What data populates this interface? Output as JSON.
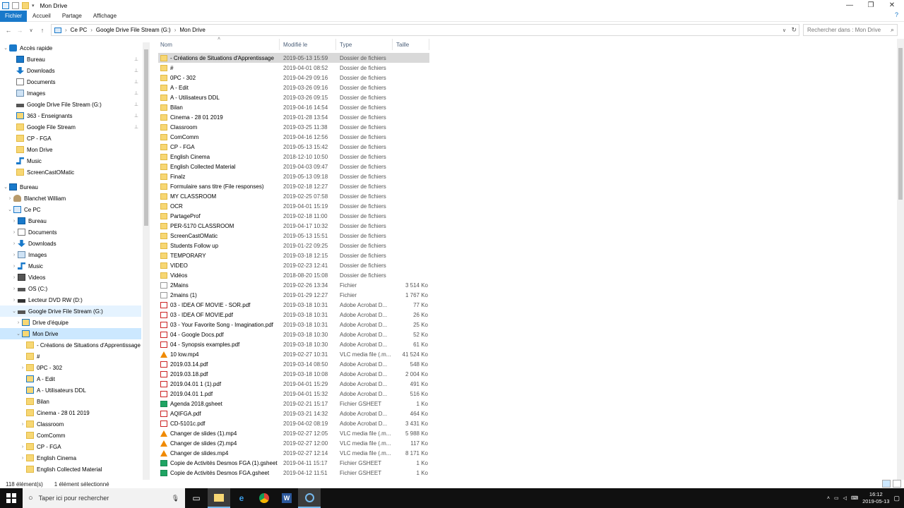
{
  "window": {
    "title": "Mon Drive"
  },
  "ribbon": {
    "tabs": [
      "Fichier",
      "Accueil",
      "Partage",
      "Affichage"
    ]
  },
  "address": {
    "segments": [
      "Ce PC",
      "Google Drive File Stream (G:)",
      "Mon Drive"
    ],
    "search_placeholder": "Rechercher dans : Mon Drive"
  },
  "nav": {
    "items": [
      {
        "label": "Accès rapide",
        "level": 0,
        "chev": "v",
        "icon": "star"
      },
      {
        "label": "Bureau",
        "level": 1,
        "icon": "desktop",
        "pin": true
      },
      {
        "label": "Downloads",
        "level": 1,
        "icon": "download",
        "pin": true
      },
      {
        "label": "Documents",
        "level": 1,
        "icon": "doc",
        "pin": true
      },
      {
        "label": "Images",
        "level": 1,
        "icon": "image",
        "pin": true
      },
      {
        "label": "Google Drive File Stream (G:)",
        "level": 1,
        "icon": "drive",
        "pin": true
      },
      {
        "label": "363 - Enseignants",
        "level": 1,
        "icon": "shared",
        "pin": true
      },
      {
        "label": "Google File Stream",
        "level": 1,
        "icon": "folder",
        "pin": true
      },
      {
        "label": "CP - FGA",
        "level": 1,
        "icon": "folder"
      },
      {
        "label": "Mon Drive",
        "level": 1,
        "icon": "folder"
      },
      {
        "label": "Music",
        "level": 1,
        "icon": "music"
      },
      {
        "label": "ScreenCastOMatic",
        "level": 1,
        "icon": "folder"
      },
      {
        "label": "Bureau",
        "level": 0,
        "chev": "v",
        "icon": "desktop",
        "gap": true
      },
      {
        "label": "Blanchet William",
        "level": 1,
        "chev": ">",
        "icon": "user"
      },
      {
        "label": "Ce PC",
        "level": 1,
        "chev": "v",
        "icon": "pc"
      },
      {
        "label": "Bureau",
        "level": 2,
        "chev": ">",
        "icon": "desktop"
      },
      {
        "label": "Documents",
        "level": 2,
        "chev": ">",
        "icon": "doc"
      },
      {
        "label": "Downloads",
        "level": 2,
        "chev": ">",
        "icon": "download"
      },
      {
        "label": "Images",
        "level": 2,
        "chev": ">",
        "icon": "image"
      },
      {
        "label": "Music",
        "level": 2,
        "chev": ">",
        "icon": "music"
      },
      {
        "label": "Videos",
        "level": 2,
        "chev": ">",
        "icon": "video"
      },
      {
        "label": "OS (C:)",
        "level": 2,
        "chev": ">",
        "icon": "drive"
      },
      {
        "label": "Lecteur DVD RW (D:)",
        "level": 2,
        "chev": ">",
        "icon": "dvd"
      },
      {
        "label": "Google Drive File Stream (G:)",
        "level": 2,
        "chev": "v",
        "icon": "drive",
        "hover": true
      },
      {
        "label": "Drive d'équipe",
        "level": 3,
        "chev": ">",
        "icon": "shared"
      },
      {
        "label": "Mon Drive",
        "level": 3,
        "chev": "v",
        "icon": "shared",
        "selected": true
      },
      {
        "label": "- Créations de Situations d'Apprentissage",
        "level": 4,
        "icon": "folder"
      },
      {
        "label": "#",
        "level": 4,
        "icon": "folder"
      },
      {
        "label": "0PC - 302",
        "level": 4,
        "chev": ">",
        "icon": "folder"
      },
      {
        "label": "A - Edit",
        "level": 4,
        "icon": "shared"
      },
      {
        "label": "A - Utilisateurs DDL",
        "level": 4,
        "icon": "shared"
      },
      {
        "label": "Bilan",
        "level": 4,
        "icon": "folder"
      },
      {
        "label": "Cinema - 28 01 2019",
        "level": 4,
        "icon": "folder"
      },
      {
        "label": "Classroom",
        "level": 4,
        "chev": ">",
        "icon": "folder"
      },
      {
        "label": "ComComm",
        "level": 4,
        "icon": "folder"
      },
      {
        "label": "CP - FGA",
        "level": 4,
        "chev": ">",
        "icon": "folder"
      },
      {
        "label": "English Cinema",
        "level": 4,
        "chev": ">",
        "icon": "folder"
      },
      {
        "label": "English Collected Material",
        "level": 4,
        "icon": "folder"
      }
    ]
  },
  "columns": {
    "name": "Nom",
    "date": "Modifié le",
    "type": "Type",
    "size": "Taille"
  },
  "files": [
    {
      "name": "- Créations de Situations d'Apprentissage",
      "date": "2019-05-13 15:59",
      "type": "Dossier de fichiers",
      "size": "",
      "icon": "folder",
      "selected": true
    },
    {
      "name": "#",
      "date": "2019-04-01 08:52",
      "type": "Dossier de fichiers",
      "size": "",
      "icon": "folder"
    },
    {
      "name": "0PC - 302",
      "date": "2019-04-29 09:16",
      "type": "Dossier de fichiers",
      "size": "",
      "icon": "folder"
    },
    {
      "name": "A - Edit",
      "date": "2019-03-26 09:16",
      "type": "Dossier de fichiers",
      "size": "",
      "icon": "folder"
    },
    {
      "name": "A - Utilisateurs DDL",
      "date": "2019-03-26 09:15",
      "type": "Dossier de fichiers",
      "size": "",
      "icon": "folder"
    },
    {
      "name": "Bilan",
      "date": "2019-04-16 14:54",
      "type": "Dossier de fichiers",
      "size": "",
      "icon": "folder"
    },
    {
      "name": "Cinema - 28 01 2019",
      "date": "2019-01-28 13:54",
      "type": "Dossier de fichiers",
      "size": "",
      "icon": "folder"
    },
    {
      "name": "Classroom",
      "date": "2019-03-25 11:38",
      "type": "Dossier de fichiers",
      "size": "",
      "icon": "folder"
    },
    {
      "name": "ComComm",
      "date": "2019-04-16 12:56",
      "type": "Dossier de fichiers",
      "size": "",
      "icon": "folder"
    },
    {
      "name": "CP - FGA",
      "date": "2019-05-13 15:42",
      "type": "Dossier de fichiers",
      "size": "",
      "icon": "folder"
    },
    {
      "name": "English Cinema",
      "date": "2018-12-10 10:50",
      "type": "Dossier de fichiers",
      "size": "",
      "icon": "folder"
    },
    {
      "name": "English Collected Material",
      "date": "2019-04-03 09:47",
      "type": "Dossier de fichiers",
      "size": "",
      "icon": "folder"
    },
    {
      "name": "Finalz",
      "date": "2019-05-13 09:18",
      "type": "Dossier de fichiers",
      "size": "",
      "icon": "folder"
    },
    {
      "name": "Formulaire sans titre (File responses)",
      "date": "2019-02-18 12:27",
      "type": "Dossier de fichiers",
      "size": "",
      "icon": "folder"
    },
    {
      "name": "MY CLASSROOM",
      "date": "2019-02-25 07:58",
      "type": "Dossier de fichiers",
      "size": "",
      "icon": "folder"
    },
    {
      "name": "OCR",
      "date": "2019-04-01 15:19",
      "type": "Dossier de fichiers",
      "size": "",
      "icon": "folder"
    },
    {
      "name": "PartageProf",
      "date": "2019-02-18 11:00",
      "type": "Dossier de fichiers",
      "size": "",
      "icon": "folder"
    },
    {
      "name": "PER-5170 CLASSROOM",
      "date": "2019-04-17 10:32",
      "type": "Dossier de fichiers",
      "size": "",
      "icon": "folder"
    },
    {
      "name": "ScreenCastOMatic",
      "date": "2019-05-13 15:51",
      "type": "Dossier de fichiers",
      "size": "",
      "icon": "folder"
    },
    {
      "name": "Students Follow up",
      "date": "2019-01-22 09:25",
      "type": "Dossier de fichiers",
      "size": "",
      "icon": "folder"
    },
    {
      "name": "TEMPORARY",
      "date": "2019-03-18 12:15",
      "type": "Dossier de fichiers",
      "size": "",
      "icon": "folder"
    },
    {
      "name": "VIDEO",
      "date": "2019-02-23 12:41",
      "type": "Dossier de fichiers",
      "size": "",
      "icon": "folder"
    },
    {
      "name": "Vidéos",
      "date": "2018-08-20 15:08",
      "type": "Dossier de fichiers",
      "size": "",
      "icon": "folder"
    },
    {
      "name": "2Mains",
      "date": "2019-02-26 13:34",
      "type": "Fichier",
      "size": "3 514 Ko",
      "icon": "file"
    },
    {
      "name": "2mains (1)",
      "date": "2019-01-29 12:27",
      "type": "Fichier",
      "size": "1 767 Ko",
      "icon": "file"
    },
    {
      "name": "03 - IDEA OF MOVIE - SOR.pdf",
      "date": "2019-03-18 10:31",
      "type": "Adobe Acrobat D...",
      "size": "77 Ko",
      "icon": "pdf"
    },
    {
      "name": "03 - IDEA OF MOVIE.pdf",
      "date": "2019-03-18 10:31",
      "type": "Adobe Acrobat D...",
      "size": "26 Ko",
      "icon": "pdf"
    },
    {
      "name": "03 - Your Favorite Song - Imagination.pdf",
      "date": "2019-03-18 10:31",
      "type": "Adobe Acrobat D...",
      "size": "25 Ko",
      "icon": "pdf"
    },
    {
      "name": "04 - Google Docs.pdf",
      "date": "2019-03-18 10:30",
      "type": "Adobe Acrobat D...",
      "size": "52 Ko",
      "icon": "pdf"
    },
    {
      "name": "04 - Synopsis examples.pdf",
      "date": "2019-03-18 10:30",
      "type": "Adobe Acrobat D...",
      "size": "61 Ko",
      "icon": "pdf"
    },
    {
      "name": "10 low.mp4",
      "date": "2019-02-27 10:31",
      "type": "VLC media file (.m...",
      "size": "41 524 Ko",
      "icon": "vlc"
    },
    {
      "name": "2019.03.14.pdf",
      "date": "2019-03-14 08:50",
      "type": "Adobe Acrobat D...",
      "size": "548 Ko",
      "icon": "pdf"
    },
    {
      "name": "2019.03.18.pdf",
      "date": "2019-03-18 10:08",
      "type": "Adobe Acrobat D...",
      "size": "2 004 Ko",
      "icon": "pdf"
    },
    {
      "name": "2019.04.01 1 (1).pdf",
      "date": "2019-04-01 15:29",
      "type": "Adobe Acrobat D...",
      "size": "491 Ko",
      "icon": "pdf"
    },
    {
      "name": "2019.04.01 1.pdf",
      "date": "2019-04-01 15:32",
      "type": "Adobe Acrobat D...",
      "size": "516 Ko",
      "icon": "pdf"
    },
    {
      "name": "Agenda 2018.gsheet",
      "date": "2019-02-21 15:17",
      "type": "Fichier GSHEET",
      "size": "1 Ko",
      "icon": "gsheet"
    },
    {
      "name": "AQIFGA.pdf",
      "date": "2019-03-21 14:32",
      "type": "Adobe Acrobat D...",
      "size": "464 Ko",
      "icon": "pdf"
    },
    {
      "name": "CD-5101c.pdf",
      "date": "2019-04-02 08:19",
      "type": "Adobe Acrobat D...",
      "size": "3 431 Ko",
      "icon": "pdf"
    },
    {
      "name": "Changer de slides (1).mp4",
      "date": "2019-02-27 12:05",
      "type": "VLC media file (.m...",
      "size": "5 988 Ko",
      "icon": "vlc"
    },
    {
      "name": "Changer de slides (2).mp4",
      "date": "2019-02-27 12:00",
      "type": "VLC media file (.m...",
      "size": "117 Ko",
      "icon": "vlc"
    },
    {
      "name": "Changer de slides.mp4",
      "date": "2019-02-27 12:14",
      "type": "VLC media file (.m...",
      "size": "8 171 Ko",
      "icon": "vlc"
    },
    {
      "name": "Copie de Activités Desmos FGA (1).gsheet",
      "date": "2019-04-11 15:17",
      "type": "Fichier GSHEET",
      "size": "1 Ko",
      "icon": "gsheet"
    },
    {
      "name": "Copie de Activités Desmos FGA.gsheet",
      "date": "2019-04-12 11:51",
      "type": "Fichier GSHEET",
      "size": "1 Ko",
      "icon": "gsheet"
    }
  ],
  "status": {
    "count": "118 élément(s)",
    "selected": "1 élément sélectionné"
  },
  "taskbar": {
    "search_placeholder": "Taper ici pour rechercher"
  },
  "clock": {
    "time": "16:12",
    "date": "2019-05-13"
  },
  "colors": {
    "accent": "#1979ca",
    "selection": "#cce8ff",
    "folder": "#f7d774"
  }
}
